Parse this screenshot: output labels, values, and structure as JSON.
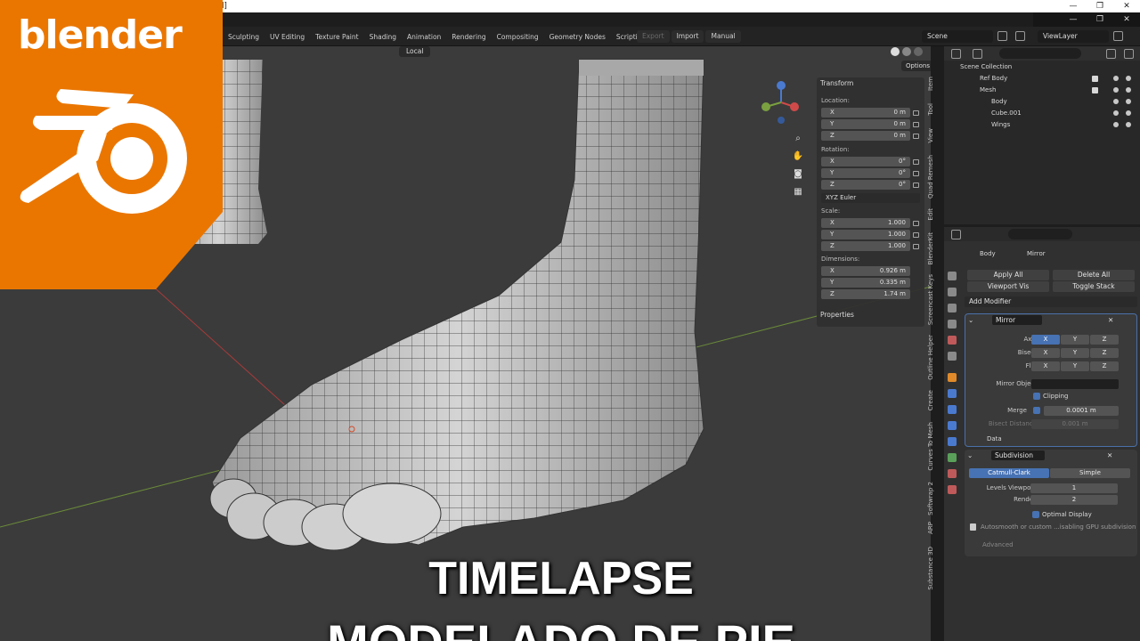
{
  "window": {
    "title_fragment": "nd]"
  },
  "logo": {
    "brand": "blender"
  },
  "topbar": {
    "tabs": [
      "Sculpting",
      "UV Editing",
      "Texture Paint",
      "Shading",
      "Animation",
      "Rendering",
      "Compositing",
      "Geometry Nodes",
      "Scripting"
    ],
    "add_tab": "+",
    "export_label": "Export",
    "import_label": "Import",
    "manual_label": "Manual",
    "scene": "Scene",
    "view_layer": "ViewLayer"
  },
  "viewport": {
    "orientation": "Local",
    "options_label": "Options"
  },
  "npanel": {
    "transform_header": "Transform",
    "location_label": "Location:",
    "location": [
      {
        "axis": "X",
        "value": "0 m"
      },
      {
        "axis": "Y",
        "value": "0 m"
      },
      {
        "axis": "Z",
        "value": "0 m"
      }
    ],
    "rotation_label": "Rotation:",
    "rotation": [
      {
        "axis": "X",
        "value": "0°"
      },
      {
        "axis": "Y",
        "value": "0°"
      },
      {
        "axis": "Z",
        "value": "0°"
      }
    ],
    "rotation_mode": "XYZ Euler",
    "scale_label": "Scale:",
    "scale": [
      {
        "axis": "X",
        "value": "1.000"
      },
      {
        "axis": "Y",
        "value": "1.000"
      },
      {
        "axis": "Z",
        "value": "1.000"
      }
    ],
    "dimensions_label": "Dimensions:",
    "dimensions": [
      {
        "axis": "X",
        "value": "0.926 m"
      },
      {
        "axis": "Y",
        "value": "0.335 m"
      },
      {
        "axis": "Z",
        "value": "1.74 m"
      }
    ],
    "properties_header": "Properties"
  },
  "side_tabs": [
    "Item",
    "Tool",
    "View",
    "Quad Remesh",
    "Edit",
    "BlenderKit",
    "Screencast Keys",
    "Outline Helper",
    "Create",
    "Curves To Mesh",
    "Softwrap 2",
    "ARP",
    "Substance 3D"
  ],
  "outliner": {
    "root": "Scene Collection",
    "items": [
      {
        "name": "Ref Body",
        "level": 1
      },
      {
        "name": "Mesh",
        "level": 1
      },
      {
        "name": "Body",
        "level": 2
      },
      {
        "name": "Cube.001",
        "level": 2
      },
      {
        "name": "Wings",
        "level": 2
      }
    ]
  },
  "properties": {
    "breadcrumb_object": "Body",
    "breadcrumb_modifier": "Mirror",
    "apply_all": "Apply All",
    "delete_all": "Delete All",
    "viewport_vis": "Viewport Vis",
    "toggle_stack": "Toggle Stack",
    "add_modifier": "Add Modifier",
    "mirror": {
      "name": "Mirror",
      "axis_label": "Axis",
      "bisect_label": "Bisect",
      "flip_label": "Flip",
      "x": "X",
      "y": "Y",
      "z": "Z",
      "mirror_object_label": "Mirror Object",
      "clipping_label": "Clipping",
      "merge_label": "Merge",
      "merge_value": "0.0001 m",
      "bisect_distance_label": "Bisect Distance",
      "bisect_distance_value": "0.001 m",
      "data_label": "Data"
    },
    "subdivision": {
      "name": "Subdivision",
      "catmull": "Catmull-Clark",
      "simple": "Simple",
      "levels_viewport_label": "Levels Viewport",
      "levels_viewport_value": "1",
      "render_label": "Render",
      "render_value": "2",
      "optimal_display_label": "Optimal Display",
      "warning": "Autosmooth or custom ...isabling GPU subdivision",
      "advanced_label": "Advanced"
    }
  },
  "overlay": {
    "line1": "TIMELAPSE",
    "line2": "MODELADO DE PIE"
  },
  "colors": {
    "brand_orange": "#ea7600",
    "accent_blue": "#4772b3",
    "viewport_bg": "#3b3b3b"
  }
}
